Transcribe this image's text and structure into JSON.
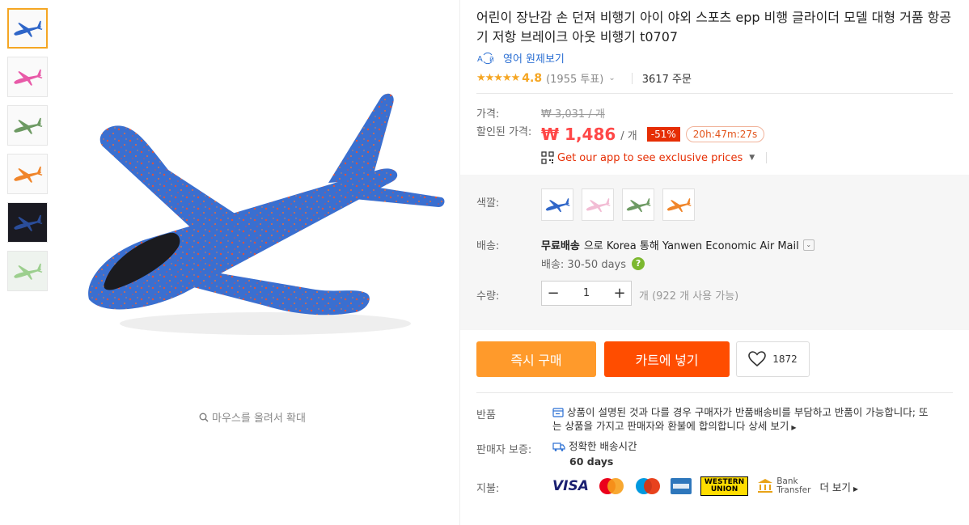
{
  "product": {
    "title": "어린이 장난감 손 던져 비행기 아이 야외 스포츠 epp 비행 글라이더 모델 대형 거품 항공기 저항 브레이크 아웃 비행기 t0707",
    "translate_label": "영어 원제보기",
    "rating": "4.8",
    "votes": "(1955 투표)",
    "orders": "3617 주문",
    "zoom_hint": "마우스를 올려서 확대",
    "thumbnails": [
      "blue",
      "pink",
      "green",
      "orange",
      "black",
      "green-light"
    ]
  },
  "pricing": {
    "price_label": "가격:",
    "original_price": "₩ 3,031 / 개",
    "discount_label": "할인된 가격:",
    "discount_price": "₩ 1,486",
    "unit": "/ 개",
    "discount_pct": "-51%",
    "timer": "20h:47m:27s",
    "app_promo": "Get our app to see exclusive prices"
  },
  "options": {
    "color_label": "색깔:",
    "colors": [
      "blue",
      "pink",
      "green",
      "orange"
    ],
    "shipping_label": "배송:",
    "shipping_free": "무료배송",
    "shipping_text": "으로 Korea 통해 Yanwen Economic Air Mail",
    "shipping_days": "배송: 30-50 days",
    "quantity_label": "수량:",
    "quantity_value": "1",
    "quantity_available": "개 (922 개 사용 가능)"
  },
  "actions": {
    "buy_now": "즉시 구매",
    "add_to_cart": "카트에 넣기",
    "wishlist_count": "1872"
  },
  "policies": {
    "return_label": "반품",
    "return_text": "상품이 설명된 것과 다를 경우 구매자가 반품배송비를 부담하고 반품이 가능합니다; 또는 상품을 가지고 판매자와 환불에 합의합니다",
    "return_more": "상세 보기",
    "guarantee_label": "판매자 보증:",
    "guarantee_text": "정확한 배송시간",
    "guarantee_days": "60 days",
    "payment_label": "지불:",
    "payment_visa": "VISA",
    "payment_wu": [
      "WESTERN",
      "UNION"
    ],
    "payment_bank": [
      "Bank",
      "Transfer"
    ],
    "payment_more": "더 보기"
  },
  "colors": {
    "accent_orange": "#ff9a2b",
    "cart_red": "#ff4d00",
    "price_red": "#ff4747",
    "star_gold": "#f5a623",
    "link_blue": "#2b6fd3"
  }
}
